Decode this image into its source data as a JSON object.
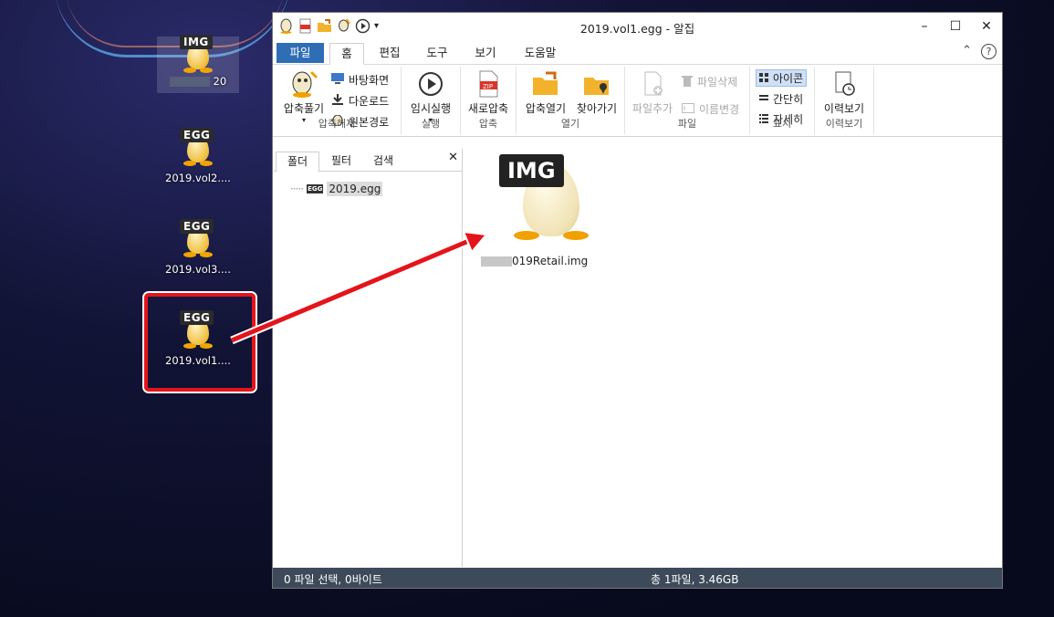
{
  "desktop": {
    "icons": [
      {
        "badge": "IMG",
        "label": "20",
        "label_prefix_blurred": true
      },
      {
        "badge": "EGG",
        "label": "2019.vol2...."
      },
      {
        "badge": "EGG",
        "label": "2019.vol3...."
      },
      {
        "badge": "EGG",
        "label": "2019.vol1...."
      }
    ]
  },
  "window": {
    "title": "2019.vol1.egg - 알집",
    "controls": {
      "minimize": "–",
      "maximize": "☐",
      "close": "✕"
    },
    "menu": {
      "file": "파일",
      "tabs": [
        "홈",
        "편집",
        "도구",
        "보기",
        "도움말"
      ],
      "active_tab": "홈",
      "help_icons": [
        "⌃",
        "?"
      ]
    },
    "ribbon": {
      "groups": [
        {
          "label": "압축해제",
          "big": {
            "label": "압축풀기",
            "arrow": "▾"
          },
          "small": [
            "바탕화면",
            "다운로드",
            "원본경로"
          ]
        },
        {
          "label": "실행",
          "big": {
            "label": "임시실행",
            "arrow": "▾"
          }
        },
        {
          "label": "압축",
          "big": {
            "label": "새로압축"
          }
        },
        {
          "label": "열기",
          "big": [
            {
              "label": "압축열기"
            },
            {
              "label": "찾아가기"
            }
          ]
        },
        {
          "label": "파일",
          "big": {
            "label": "파일추가"
          },
          "small": [
            "파일삭제",
            "이름변경"
          ]
        },
        {
          "label": "표시",
          "small": [
            "아이콘",
            "간단히",
            "자세히"
          ],
          "selected": "아이콘"
        },
        {
          "label": "이력보기",
          "big": {
            "label": "이력보기"
          }
        }
      ]
    },
    "left_pane": {
      "tabs": [
        "폴더",
        "필터",
        "검색"
      ],
      "active_tab": "폴더",
      "close": "✕",
      "tree": [
        {
          "label": "2019.egg",
          "badge": "EGG"
        }
      ]
    },
    "right_pane": {
      "files": [
        {
          "badge": "IMG",
          "name": "019Retail.img",
          "name_prefix_blurred": true
        }
      ]
    },
    "status": {
      "left": "0 파일 선택,  0바이트",
      "middle": "총 1파일,  3.46GB"
    }
  },
  "colors": {
    "accent": "#2f6db5",
    "status_bg": "#3d4a5a",
    "highlight_red": "#e3151b",
    "egg_yellow": "#f0c040"
  }
}
